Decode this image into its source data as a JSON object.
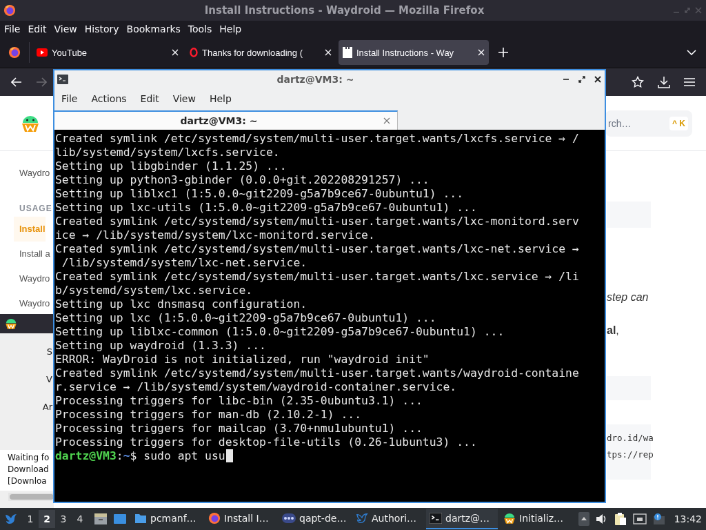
{
  "firefox": {
    "title": "Install Instructions - Waydroid — Mozilla Firefox",
    "menu": [
      "File",
      "Edit",
      "View",
      "History",
      "Bookmarks",
      "Tools",
      "Help"
    ],
    "tabs": [
      {
        "label": "YouTube",
        "kind": "youtube",
        "selected": false
      },
      {
        "label": "Thanks for downloading (",
        "kind": "opera",
        "selected": false
      },
      {
        "label": "Install Instructions - Way",
        "kind": "page",
        "selected": true
      }
    ],
    "page": {
      "search": {
        "placeholder": "rch…",
        "shortcut": "^ K"
      },
      "sidebar": [
        {
          "label": "Waydro",
          "kind": "link",
          "selected": false
        },
        {
          "label": "USAGE",
          "kind": "heading"
        },
        {
          "label": "Install",
          "kind": "link",
          "selected": true
        },
        {
          "label": "Install a",
          "kind": "link",
          "selected": false
        },
        {
          "label": "Waydro",
          "kind": "link",
          "selected": false
        },
        {
          "label": "Waydro",
          "kind": "link",
          "selected": false
        }
      ],
      "content": {
        "italic_text": "step can",
        "bold_text": "**al**,",
        "code_lines": [
          "dro.id/wa",
          "tps://rep"
        ]
      }
    }
  },
  "dialog": {
    "labels": [
      "S",
      "V",
      "Ar"
    ],
    "log": [
      "Waiting fo",
      "Download",
      "[Downloa"
    ]
  },
  "terminal": {
    "title": "dartz@VM3: ~",
    "menu": [
      "File",
      "Actions",
      "Edit",
      "View",
      "Help"
    ],
    "tab": "dartz@VM3: ~",
    "lines": [
      "Created symlink /etc/systemd/system/multi-user.target.wants/lxcfs.service → /",
      "lib/systemd/system/lxcfs.service.",
      "Setting up libgbinder (1.1.25) ...",
      "Setting up python3-gbinder (0.0.0+git.202208291257) ...",
      "Setting up liblxc1 (1:5.0.0~git2209-g5a7b9ce67-0ubuntu1) ...",
      "Setting up lxc-utils (1:5.0.0~git2209-g5a7b9ce67-0ubuntu1) ...",
      "Created symlink /etc/systemd/system/multi-user.target.wants/lxc-monitord.serv",
      "ice → /lib/systemd/system/lxc-monitord.service.",
      "Created symlink /etc/systemd/system/multi-user.target.wants/lxc-net.service →",
      " /lib/systemd/system/lxc-net.service.",
      "Created symlink /etc/systemd/system/multi-user.target.wants/lxc.service → /li",
      "b/systemd/system/lxc.service.",
      "Setting up lxc dnsmasq configuration.",
      "Setting up lxc (1:5.0.0~git2209-g5a7b9ce67-0ubuntu1) ...",
      "Setting up liblxc-common (1:5.0.0~git2209-g5a7b9ce67-0ubuntu1) ...",
      "Setting up waydroid (1.3.3) ...",
      "ERROR: WayDroid is not initialized, run \"waydroid init\"",
      "Created symlink /etc/systemd/system/multi-user.target.wants/waydroid-containe",
      "r.service → /lib/systemd/system/waydroid-container.service.",
      "Processing triggers for libc-bin (2.35-0ubuntu3.1) ...",
      "Processing triggers for man-db (2.10.2-1) ...",
      "Processing triggers for mailcap (3.70+nmu1ubuntu1) ...",
      "Processing triggers for desktop-file-utils (0.26-1ubuntu3) ..."
    ],
    "prompt": {
      "user": "dartz@VM3",
      "separator": ":",
      "path": "~",
      "command": "$ sudo apt usu"
    }
  },
  "taskbar": {
    "workspaces": [
      {
        "label": "1",
        "selected": false
      },
      {
        "label": "2",
        "selected": true
      },
      {
        "label": "3",
        "selected": false
      },
      {
        "label": "4",
        "selected": false
      }
    ],
    "tasks": [
      {
        "label": "pcmanf…",
        "kind": "folder",
        "selected": false
      },
      {
        "label": "Install I…",
        "kind": "firefox",
        "selected": false
      },
      {
        "label": "qapt-de…",
        "kind": "dots",
        "selected": false
      },
      {
        "label": "Authori…",
        "kind": "bird",
        "selected": false
      },
      {
        "label": "dartz@…",
        "kind": "terminal",
        "selected": true
      },
      {
        "label": "Initializ…",
        "kind": "waydroid",
        "selected": false
      }
    ],
    "clock": "13:42"
  }
}
